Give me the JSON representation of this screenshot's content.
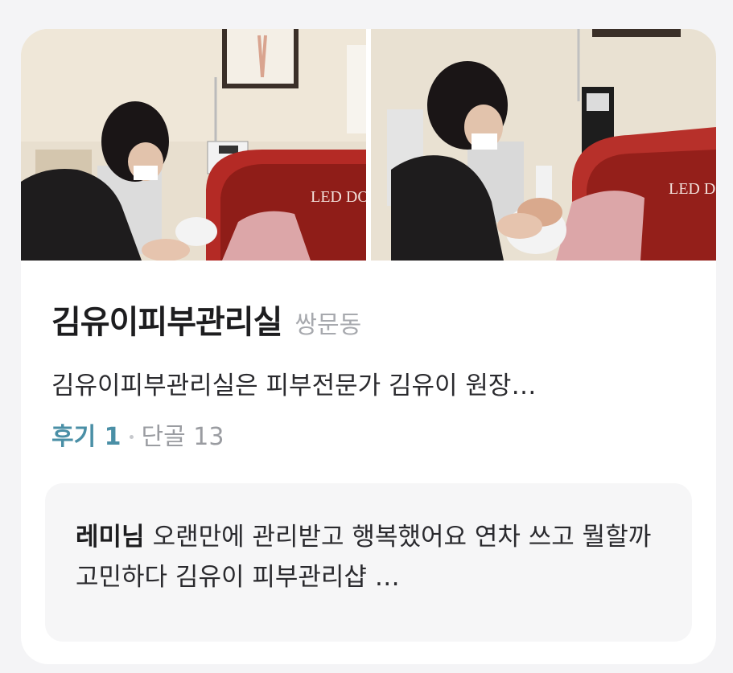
{
  "shop": {
    "name": "김유이피부관리실",
    "location": "쌍문동",
    "description": "김유이피부관리실은 피부전문가 김유이 원장…",
    "reviews_label": "후기 1",
    "regulars_label": "단골 13"
  },
  "photos": [
    {
      "alt": "skin care treatment photo",
      "device_label": "LED DO"
    },
    {
      "alt": "skin care treatment photo",
      "device_label": "LED D"
    }
  ],
  "review": {
    "author": "레미님",
    "text": "오랜만에 관리받고 행복했어요 연차 쓰고 뭘할까 고민하다 김유이 피부관리샵 …"
  }
}
